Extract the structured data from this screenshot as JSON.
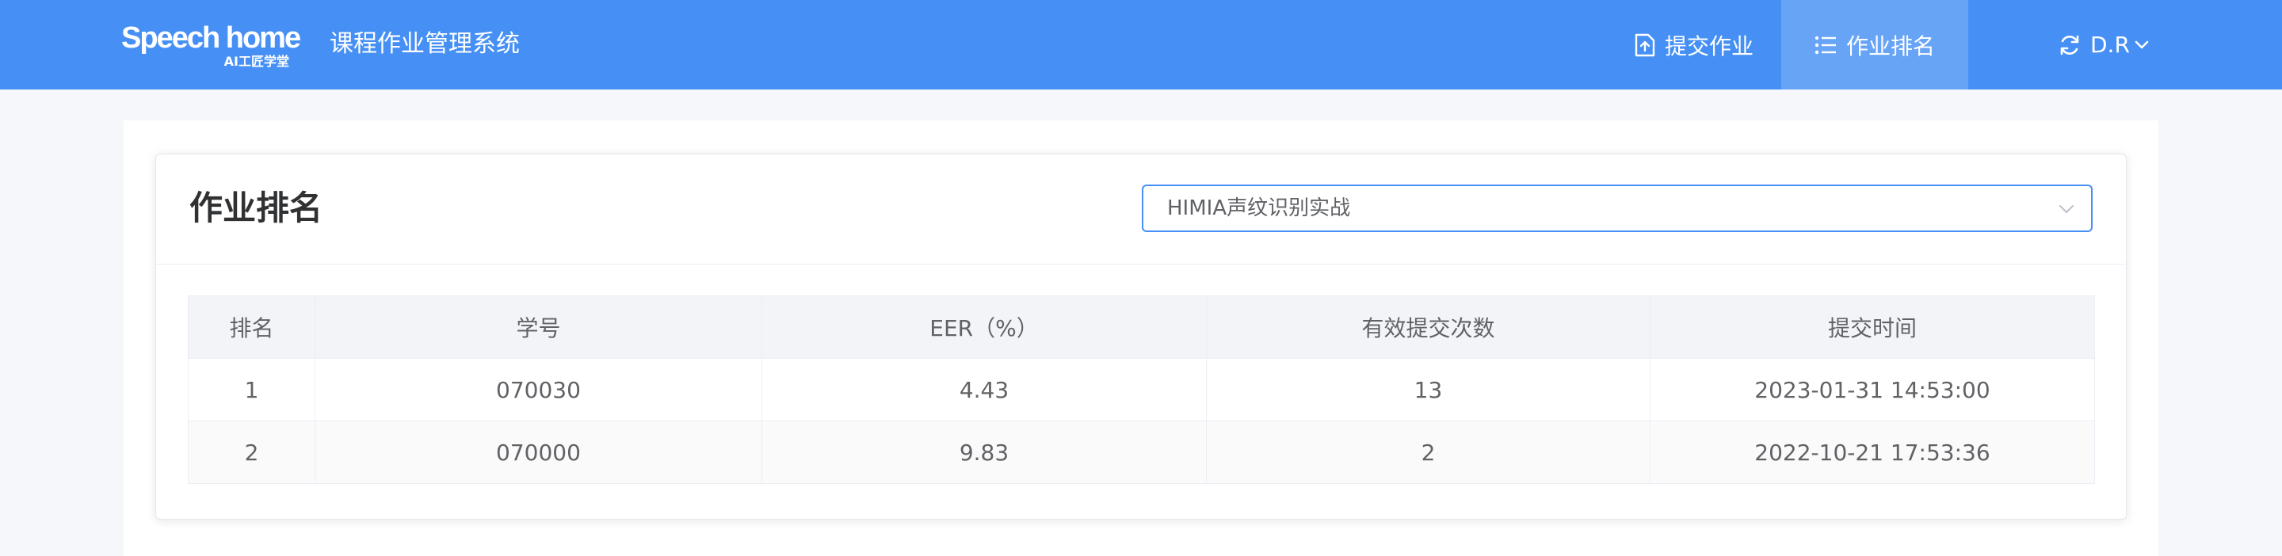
{
  "header": {
    "logo_main": "Speech home",
    "logo_sub": "AI工匠学堂",
    "system_title": "课程作业管理系统",
    "nav": {
      "submit_label": "提交作业",
      "submit_icon": "upload-file-icon",
      "rank_label": "作业排名",
      "rank_icon": "list-icon"
    },
    "user": {
      "name": "D.R",
      "icon": "refresh-icon"
    },
    "bg_color": "#4690f5"
  },
  "card": {
    "title": "作业排名",
    "select": {
      "value": "HIMIA声纹识别实战"
    }
  },
  "table": {
    "headers": [
      "排名",
      "学号",
      "EER（%）",
      "有效提交次数",
      "提交时间"
    ],
    "rows": [
      [
        "1",
        "070030",
        "4.43",
        "13",
        "2023-01-31 14:53:00"
      ],
      [
        "2",
        "070000",
        "9.83",
        "2",
        "2022-10-21 17:53:36"
      ]
    ]
  }
}
